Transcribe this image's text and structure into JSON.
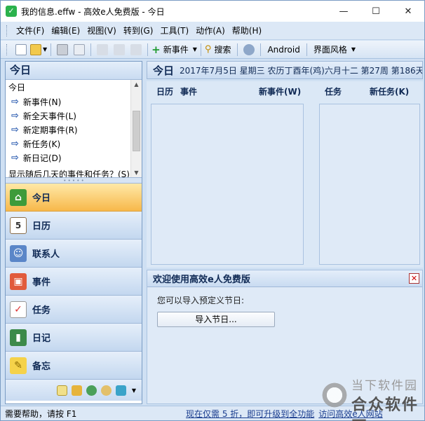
{
  "window": {
    "title": "我的信息.effw - 高效e人免费版 - 今日",
    "minimize": "—",
    "maximize": "☐",
    "close": "✕"
  },
  "menu": [
    "文件(F)",
    "编辑(E)",
    "视图(V)",
    "转到(G)",
    "工具(T)",
    "动作(A)",
    "帮助(H)"
  ],
  "toolbar": {
    "new_event": "新事件",
    "search": "搜索",
    "android": "Android",
    "theme": "界面风格"
  },
  "left_panel": {
    "title": "今日",
    "today_label": "今日",
    "items": [
      "新事件(N)",
      "新全天事件(L)",
      "新定期事件(R)",
      "新任务(K)",
      "新日记(D)"
    ],
    "cut_line": "显示随后几天的事件和任务？(S)",
    "nav": [
      {
        "label": "今日",
        "icon": "home-icon"
      },
      {
        "label": "日历",
        "icon": "calendar-icon"
      },
      {
        "label": "联系人",
        "icon": "contacts-icon"
      },
      {
        "label": "事件",
        "icon": "event-icon"
      },
      {
        "label": "任务",
        "icon": "task-icon"
      },
      {
        "label": "日记",
        "icon": "diary-icon"
      },
      {
        "label": "备忘",
        "icon": "memo-icon"
      }
    ]
  },
  "right_header": {
    "title": "今日",
    "date": "2017年7月5日  星期三  农历丁酉年(鸡)六月十二  第27周  第186天"
  },
  "calendar": {
    "col_calendar": "日历",
    "col_event": "事件",
    "col_new_event": "新事件(W)",
    "col_task": "任务",
    "col_new_task": "新任务(K)"
  },
  "welcome": {
    "title": "欢迎使用高效e人免费版",
    "text": "您可以导入预定义节日:",
    "import_button": "导入节日..."
  },
  "status": {
    "help": "需要帮助，请按 F1",
    "upgrade": "现在仅需 5 折，即可升级到全功能",
    "visit": "访问高效e人网站"
  },
  "watermark": {
    "top": "当下软件园",
    "bottom": "合众软件园"
  },
  "colors": {
    "accent": "#2a5bb0",
    "active_nav": "#f7b84a"
  }
}
